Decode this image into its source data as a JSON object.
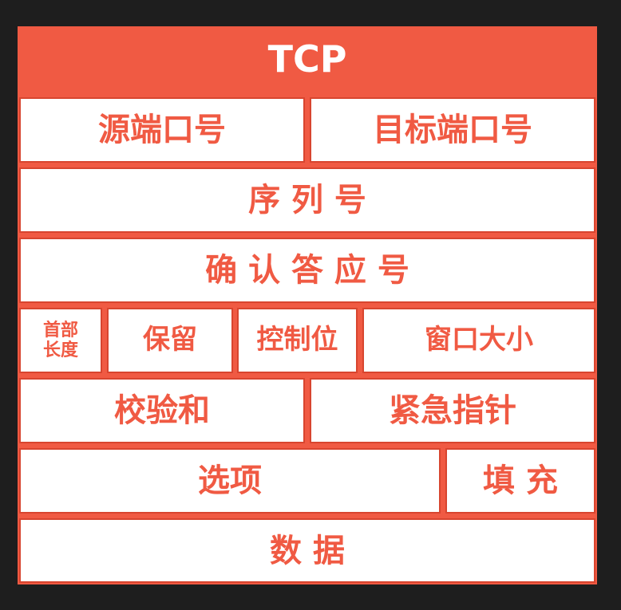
{
  "title": "TCP",
  "rows": [
    [
      "源端口号",
      "目标端口号"
    ],
    [
      "序 列 号"
    ],
    [
      "确 认 答 应 号"
    ],
    [
      "首部\n长度",
      "保留",
      "控制位",
      "窗口大小"
    ],
    [
      "校验和",
      "紧急指针"
    ],
    [
      "选项",
      "填 充"
    ],
    [
      "数 据"
    ]
  ],
  "colors": {
    "accent": "#f05a43",
    "background": "#1e1e1e",
    "cell": "#ffffff"
  }
}
